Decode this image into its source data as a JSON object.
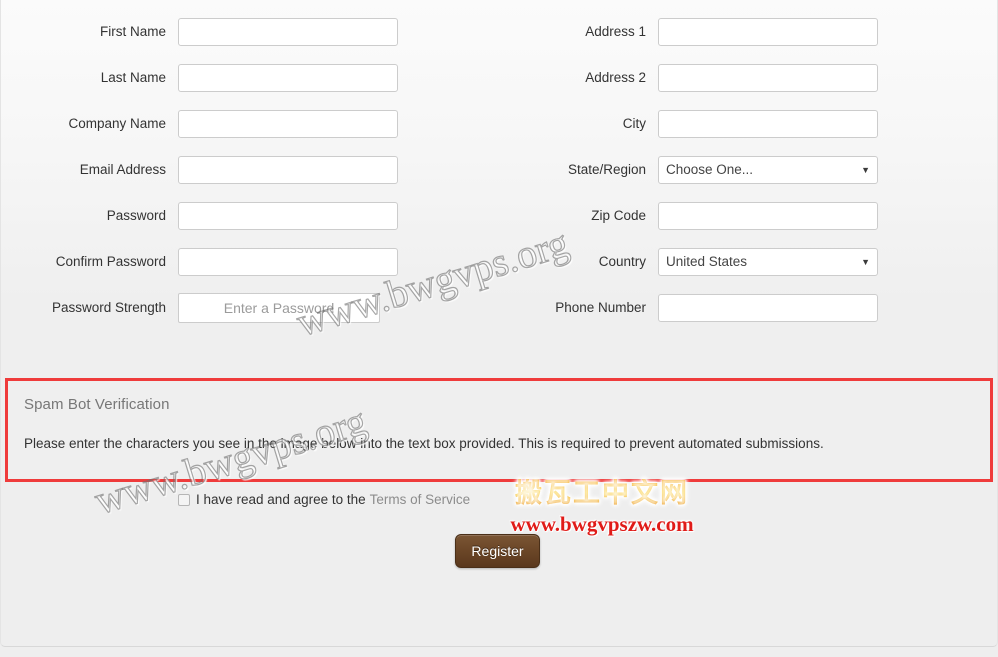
{
  "form": {
    "left_column": [
      {
        "label": "First Name",
        "type": "text",
        "value": "",
        "placeholder": ""
      },
      {
        "label": "Last Name",
        "type": "text",
        "value": "",
        "placeholder": ""
      },
      {
        "label": "Company Name",
        "type": "text",
        "value": "",
        "placeholder": ""
      },
      {
        "label": "Email Address",
        "type": "text",
        "value": "",
        "placeholder": ""
      },
      {
        "label": "Password",
        "type": "text",
        "value": "",
        "placeholder": ""
      },
      {
        "label": "Confirm Password",
        "type": "text",
        "value": "",
        "placeholder": ""
      },
      {
        "label": "Password Strength",
        "type": "meter",
        "value": "Enter a Password"
      }
    ],
    "right_column": [
      {
        "label": "Address 1",
        "type": "text",
        "value": "",
        "placeholder": ""
      },
      {
        "label": "Address 2",
        "type": "text",
        "value": "",
        "placeholder": ""
      },
      {
        "label": "City",
        "type": "text",
        "value": "",
        "placeholder": ""
      },
      {
        "label": "State/Region",
        "type": "select",
        "value": "Choose One...",
        "arrow": "▼"
      },
      {
        "label": "Zip Code",
        "type": "text",
        "value": "",
        "placeholder": ""
      },
      {
        "label": "Country",
        "type": "select",
        "value": "United States",
        "arrow": "▼"
      },
      {
        "label": "Phone Number",
        "type": "text",
        "value": "",
        "placeholder": ""
      }
    ]
  },
  "spam_verification": {
    "title": "Spam Bot Verification",
    "description": "Please enter the characters you see in the image below into the text box provided. This is required to prevent automated submissions.",
    "highlight_color": "#ef3b3b"
  },
  "agreement": {
    "text": "I have read and agree to the",
    "link_label": "Terms of Service",
    "checked": false
  },
  "actions": {
    "register_label": "Register",
    "register_color": "#6b4627"
  },
  "watermarks": {
    "site_text": "www.bwgvps.org",
    "brand_cn": "搬瓦工中文网",
    "brand_url": "www.bwgvpszw.com",
    "brand_cn_color": "#f5a623",
    "brand_url_color": "#e01b18"
  }
}
